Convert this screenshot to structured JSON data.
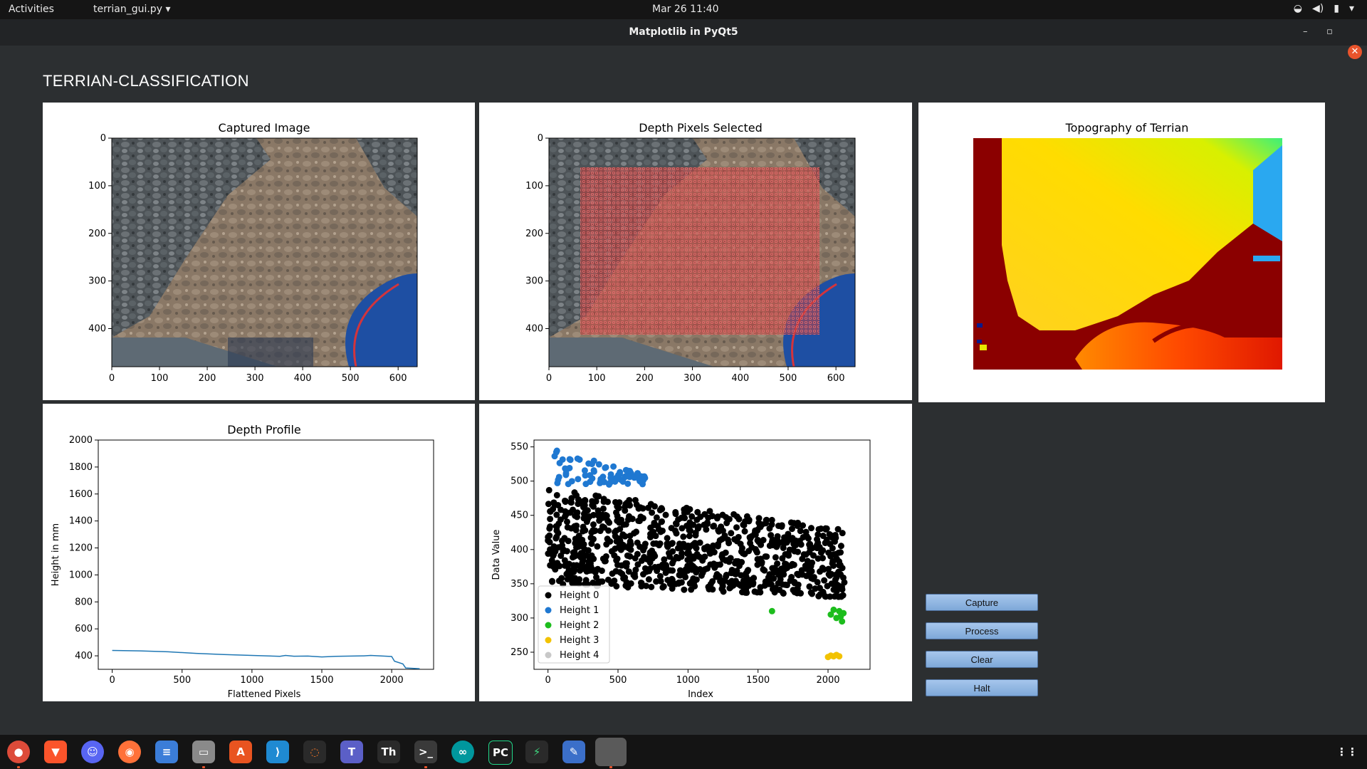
{
  "topbar": {
    "activities": "Activities",
    "app_menu": "terrian_gui.py",
    "clock": "Mar 26  11:40"
  },
  "window": {
    "title": "Matplotlib in PyQt5"
  },
  "page": {
    "heading": "TERRIAN-CLASSIFICATION"
  },
  "panels": {
    "captured": {
      "title": "Captured Image",
      "x_ticks": [
        "0",
        "100",
        "200",
        "300",
        "400",
        "500",
        "600"
      ],
      "y_ticks": [
        "0",
        "100",
        "200",
        "300",
        "400"
      ]
    },
    "depth_selected": {
      "title": "Depth Pixels Selected",
      "x_ticks": [
        "0",
        "100",
        "200",
        "300",
        "400",
        "500",
        "600"
      ],
      "y_ticks": [
        "0",
        "100",
        "200",
        "300",
        "400"
      ]
    },
    "topography": {
      "title": "Topography of Terrian"
    }
  },
  "chart_data": [
    {
      "type": "line",
      "title": "Depth Profile",
      "xlabel": "Flattened Pixels",
      "ylabel": "Height in mm",
      "xlim": [
        -100,
        2300
      ],
      "ylim": [
        300,
        2000
      ],
      "x_ticks": [
        "0",
        "500",
        "1000",
        "1500",
        "2000"
      ],
      "y_ticks": [
        "400",
        "600",
        "800",
        "1000",
        "1200",
        "1400",
        "1600",
        "1800",
        "2000"
      ],
      "series": [
        {
          "color": "#1f77b4",
          "x": [
            0,
            200,
            400,
            600,
            800,
            1000,
            1200,
            1240,
            1300,
            1400,
            1500,
            1600,
            1800,
            1850,
            2000,
            2020,
            2080,
            2100,
            2200
          ],
          "values": [
            440,
            437,
            430,
            418,
            410,
            403,
            396,
            403,
            397,
            398,
            392,
            396,
            400,
            403,
            395,
            360,
            340,
            310,
            305
          ]
        }
      ]
    },
    {
      "type": "scatter",
      "title": "",
      "xlabel": "Index",
      "ylabel": "Data Value",
      "xlim": [
        -100,
        2300
      ],
      "ylim": [
        225,
        560
      ],
      "x_ticks": [
        "0",
        "500",
        "1000",
        "1500",
        "2000"
      ],
      "y_ticks": [
        "250",
        "300",
        "350",
        "400",
        "450",
        "500",
        "550"
      ],
      "legend_position": "lower-left",
      "series": [
        {
          "name": "Height 0",
          "color": "#000000",
          "x_range": [
            0,
            2120
          ],
          "y_range": [
            330,
            490
          ]
        },
        {
          "name": "Height 1",
          "color": "#1f78d1",
          "x_range": [
            40,
            700
          ],
          "y_range": [
            495,
            548
          ]
        },
        {
          "name": "Height 2",
          "color": "#1dbd1d",
          "points": [
            [
              1600,
              310
            ],
            [
              2020,
              305
            ],
            [
              2060,
              300
            ],
            [
              2080,
              310
            ],
            [
              2100,
              295
            ],
            [
              2110,
              307
            ],
            [
              2040,
              312
            ],
            [
              2090,
              302
            ]
          ]
        },
        {
          "name": "Height 3",
          "color": "#f2c200",
          "points": [
            [
              2000,
              243
            ],
            [
              2020,
              245
            ],
            [
              2040,
              244
            ],
            [
              2060,
              246
            ],
            [
              2080,
              244
            ]
          ]
        },
        {
          "name": "Height 4",
          "color": "#c8c8c8",
          "points": []
        }
      ]
    }
  ],
  "buttons": {
    "capture": "Capture",
    "process": "Process",
    "clear": "Clear",
    "halt": "Halt"
  },
  "dock": {
    "items": [
      "chrome-icon",
      "brave-icon",
      "discord-icon",
      "firefox-icon",
      "text-editor-icon",
      "files-icon",
      "software-center-icon",
      "vscode-icon",
      "jupyter-icon",
      "teams-icon",
      "font-manager-icon",
      "terminal-icon",
      "arduino-icon",
      "pycharm-icon",
      "powerup-icon",
      "notes-icon",
      "python-window-icon"
    ]
  }
}
